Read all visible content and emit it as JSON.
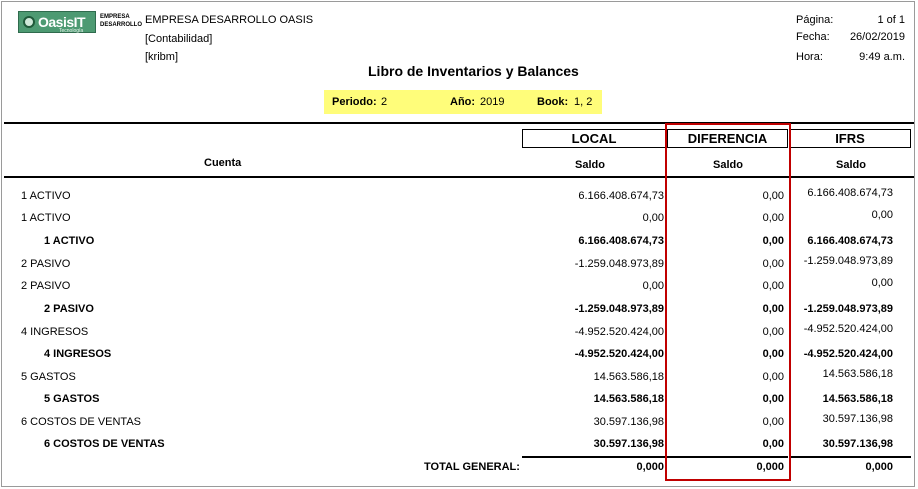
{
  "header": {
    "logo_text": "OasisIT",
    "logo_subtext": "Tecnología",
    "logo_caption_line1": "EMPRESA",
    "logo_caption_line2": "DESARROLLO",
    "company": "EMPRESA DESARROLLO OASIS",
    "module": "[Contabilidad]",
    "user": "[kribm]",
    "title": "Libro de Inventarios y Balances",
    "meta": {
      "page_label": "Página:",
      "page_value": "1 of 1",
      "date_label": "Fecha:",
      "date_value": "26/02/2019",
      "time_label": "Hora:",
      "time_value": "9:49 a.m."
    }
  },
  "filters": {
    "periodo_label": "Periodo:",
    "periodo_value": "2",
    "anio_label": "Año:",
    "anio_value": "2019",
    "book_label": "Book:",
    "book_value": "1, 2"
  },
  "columns": {
    "cuenta": "Cuenta",
    "local": "LOCAL",
    "diferencia": "DIFERENCIA",
    "ifrs": "IFRS",
    "saldo": "Saldo"
  },
  "rows": [
    {
      "name": "1 ACTIVO",
      "local": "6.166.408.674,73",
      "diff": "0,00",
      "ifrs": "6.166.408.674,73",
      "bold": false
    },
    {
      "name": "1 ACTIVO",
      "local": "0,00",
      "diff": "0,00",
      "ifrs": "0,00",
      "bold": false
    },
    {
      "name": "1  ACTIVO",
      "local": "6.166.408.674,73",
      "diff": "0,00",
      "ifrs": "6.166.408.674,73",
      "bold": true
    },
    {
      "name": "2 PASIVO",
      "local": "-1.259.048.973,89",
      "diff": "0,00",
      "ifrs": "-1.259.048.973,89",
      "bold": false
    },
    {
      "name": "2 PASIVO",
      "local": "0,00",
      "diff": "0,00",
      "ifrs": "0,00",
      "bold": false
    },
    {
      "name": "2  PASIVO",
      "local": "-1.259.048.973,89",
      "diff": "0,00",
      "ifrs": "-1.259.048.973,89",
      "bold": true
    },
    {
      "name": "4 INGRESOS",
      "local": "-4.952.520.424,00",
      "diff": "0,00",
      "ifrs": "-4.952.520.424,00",
      "bold": false
    },
    {
      "name": "4  INGRESOS",
      "local": "-4.952.520.424,00",
      "diff": "0,00",
      "ifrs": "-4.952.520.424,00",
      "bold": true
    },
    {
      "name": "5 GASTOS",
      "local": "14.563.586,18",
      "diff": "0,00",
      "ifrs": "14.563.586,18",
      "bold": false
    },
    {
      "name": "5  GASTOS",
      "local": "14.563.586,18",
      "diff": "0,00",
      "ifrs": "14.563.586,18",
      "bold": true
    },
    {
      "name": "6 COSTOS DE VENTAS",
      "local": "30.597.136,98",
      "diff": "0,00",
      "ifrs": "30.597.136,98",
      "bold": false
    },
    {
      "name": "6  COSTOS DE VENTAS",
      "local": "30.597.136,98",
      "diff": "0,00",
      "ifrs": "30.597.136,98",
      "bold": true
    }
  ],
  "total": {
    "label": "TOTAL GENERAL:",
    "local": "0,000",
    "diff": "0,000",
    "ifrs": "0,000"
  },
  "highlight_color": "#fffd7a",
  "annotation_color": "#c00000"
}
